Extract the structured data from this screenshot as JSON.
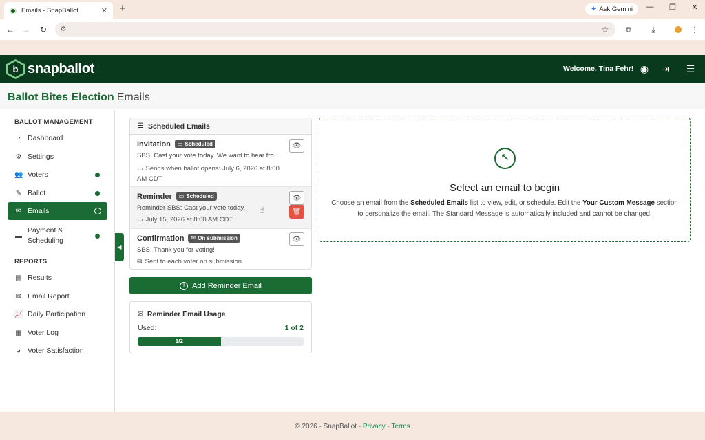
{
  "browser": {
    "tab_title": "Emails - SnapBallot",
    "new_tab": "+",
    "ask_gemini": "Ask Gemini"
  },
  "header": {
    "brand_letter": "b",
    "brand": "snapballot",
    "welcome": "Welcome, Tina Fehr!"
  },
  "page": {
    "election": "Ballot Bites Election",
    "section": "Emails"
  },
  "sidebar": {
    "ballot_heading": "BALLOT MANAGEMENT",
    "reports_heading": "REPORTS",
    "items": [
      {
        "label": "Dashboard"
      },
      {
        "label": "Settings"
      },
      {
        "label": "Voters"
      },
      {
        "label": "Ballot"
      },
      {
        "label": "Emails"
      },
      {
        "label": "Payment &"
      },
      {
        "label": "Scheduling"
      }
    ],
    "reports": [
      {
        "label": "Results"
      },
      {
        "label": "Email Report"
      },
      {
        "label": "Daily Participation"
      },
      {
        "label": "Voter Log"
      },
      {
        "label": "Voter Satisfaction"
      }
    ]
  },
  "scheduled": {
    "title": "Scheduled Emails",
    "emails": [
      {
        "title": "Invitation",
        "badge": "Scheduled",
        "text": "SBS: Cast your vote today. We want to hear from y...",
        "meta": "Sends when ballot opens: July 6, 2026 at 8:00 AM CDT"
      },
      {
        "title": "Reminder",
        "badge": "Scheduled",
        "text": "Reminder SBS: Cast your vote today.",
        "meta": "July 15, 2026 at 8:00 AM CDT"
      },
      {
        "title": "Confirmation",
        "badge": "On submission",
        "text": "SBS: Thank you for voting!",
        "meta": "Sent to each voter on submission"
      }
    ]
  },
  "add_reminder": "Add Reminder Email",
  "usage": {
    "title": "Reminder Email Usage",
    "used_label": "Used:",
    "used_value": "1 of 2",
    "progress_label": "1/2",
    "progress_fraction": 0.5
  },
  "detail": {
    "title": "Select an email to begin",
    "body_1": "Choose an email from the ",
    "body_bold_1": "Scheduled Emails",
    "body_2": " list to view, edit, or schedule. Edit the ",
    "body_bold_2": "Your Custom Message",
    "body_3": " section to personalize the email. The Standard Message is automatically included and cannot be changed."
  },
  "footer": {
    "copyright": "© 2026 - SnapBallot - ",
    "privacy": "Privacy",
    "sep": " - ",
    "terms": "Terms"
  },
  "colors": {
    "brand_dark": "#0a3a1e",
    "brand_green": "#1b6b35",
    "danger": "#e15443"
  }
}
